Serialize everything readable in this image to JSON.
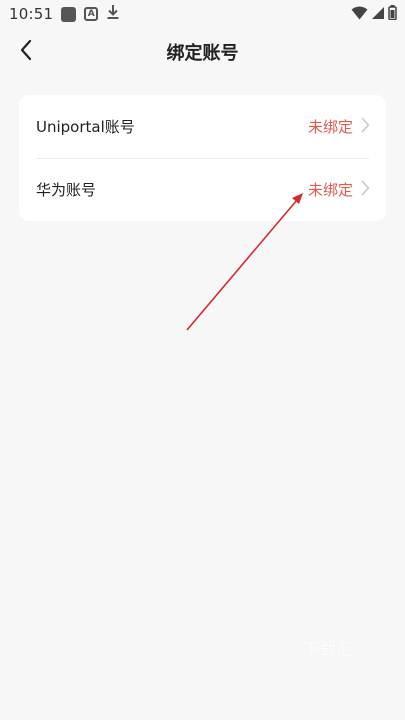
{
  "status_bar": {
    "time": "10:51"
  },
  "header": {
    "title": "绑定账号"
  },
  "accounts": [
    {
      "label": "Uniportal账号",
      "status": "未绑定"
    },
    {
      "label": "华为账号",
      "status": "未绑定"
    }
  ],
  "colors": {
    "status_red": "#e05a4e",
    "background": "#f7f7f7",
    "card": "#ffffff",
    "annotation_arrow": "#d9282d"
  },
  "watermark": {
    "text": "下载汇"
  }
}
